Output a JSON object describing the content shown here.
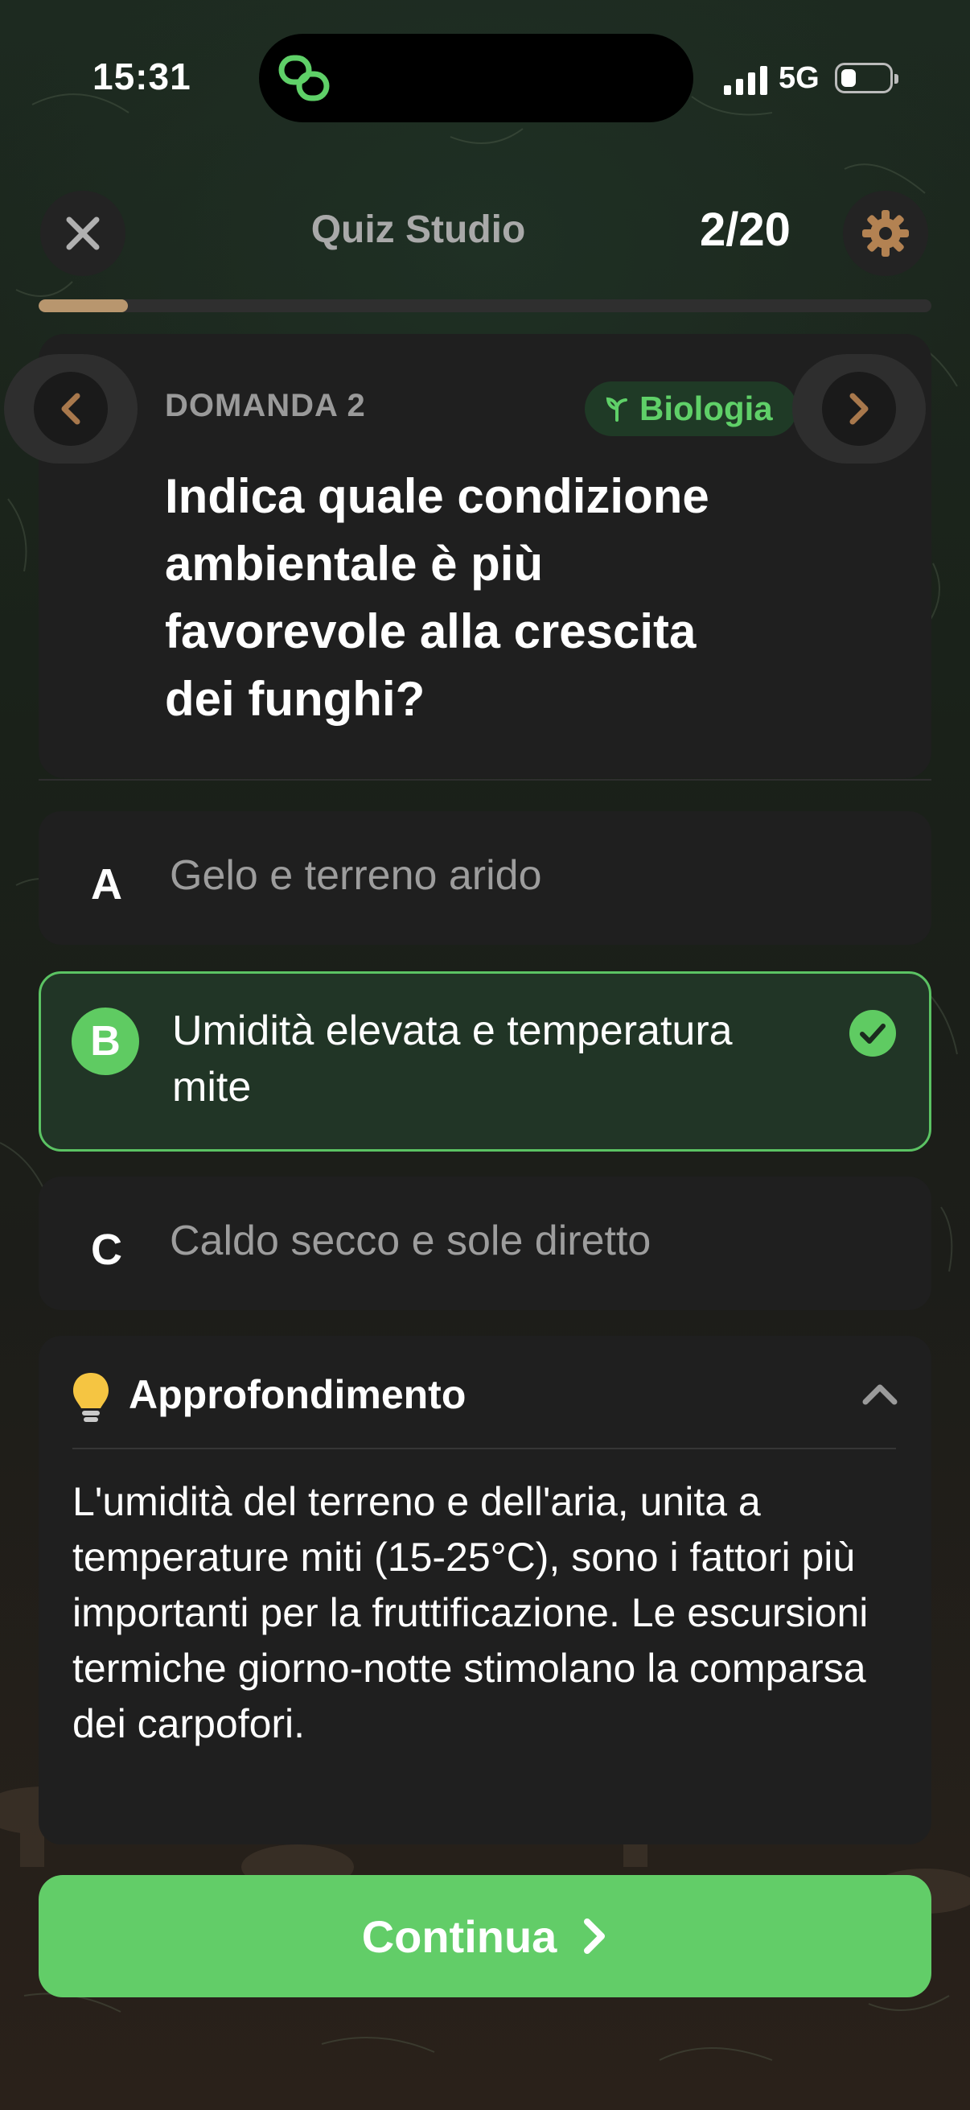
{
  "status_bar": {
    "time": "15:31",
    "network": "5G"
  },
  "header": {
    "title": "Quiz Studio",
    "counter": "2/20",
    "progress": 0.1
  },
  "question": {
    "label": "DOMANDA 2",
    "category": "Biologia",
    "text": "Indica quale condizione ambientale è più favorevole alla crescita dei funghi?"
  },
  "answers": [
    {
      "letter": "A",
      "text": "Gelo e terreno arido",
      "selected": false
    },
    {
      "letter": "B",
      "text": "Umidità elevata e temperatura mite",
      "selected": true
    },
    {
      "letter": "C",
      "text": "Caldo secco e sole diretto",
      "selected": false
    }
  ],
  "explanation": {
    "title": "Approfondimento",
    "text": "L'umidità del terreno e dell'aria, unita a temperature miti (15-25°C), sono i fattori più importanti per la fruttificazione. Le escursioni termiche giorno-notte stimolano la comparsa dei carpofori."
  },
  "footer": {
    "continue_label": "Continua"
  },
  "colors": {
    "accent_green": "#62cd68",
    "progress": "#b8966e",
    "card": "#1f1f1f"
  }
}
